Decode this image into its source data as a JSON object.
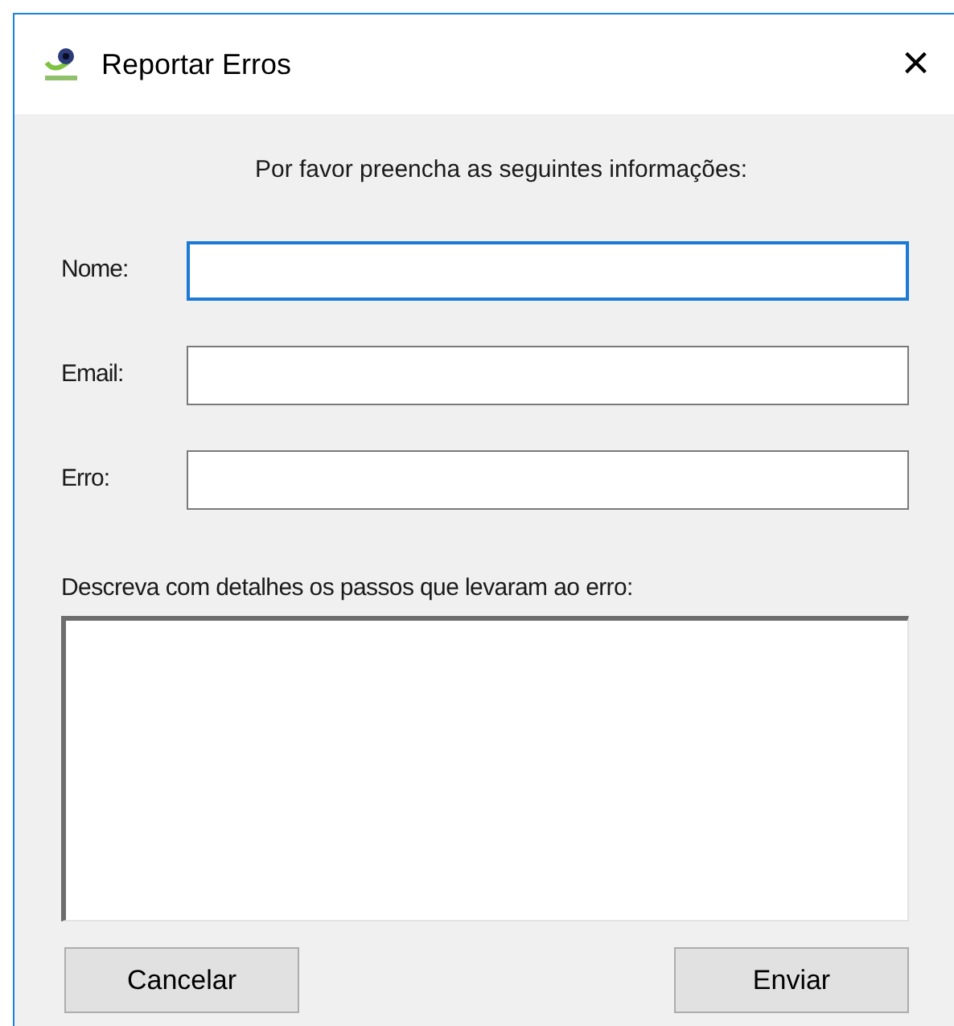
{
  "window": {
    "title": "Reportar Erros",
    "close": "×"
  },
  "instruction": "Por favor preencha as seguintes informações:",
  "fields": [
    {
      "label": "Nome:",
      "focused": true
    },
    {
      "label": "Email:",
      "focused": false
    },
    {
      "label": "Erro:",
      "focused": false
    }
  ],
  "description": {
    "label": "Descreva com detalhes os passos que levaram ao erro:"
  },
  "buttons": [
    "Cancelar",
    "Enviar"
  ]
}
